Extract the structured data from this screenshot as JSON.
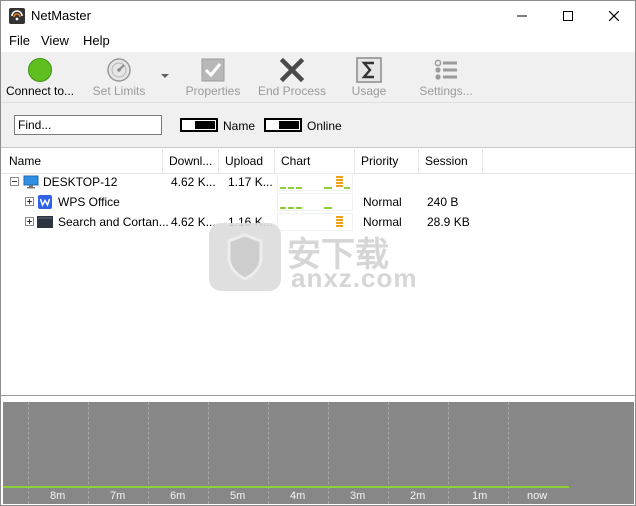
{
  "window": {
    "title": "NetMaster"
  },
  "menu": [
    "File",
    "View",
    "Help"
  ],
  "toolbar": {
    "connect": "Connect to...",
    "set_limits": "Set Limits",
    "properties": "Properties",
    "end_process": "End Process",
    "usage": "Usage",
    "settings": "Settings..."
  },
  "filter": {
    "find_placeholder": "Find...",
    "toggle1_label": "Name",
    "toggle2_label": "Online"
  },
  "table": {
    "columns": [
      "Name",
      "Downl...",
      "Upload",
      "Chart",
      "Priority",
      "Session"
    ],
    "rows": [
      {
        "name": "DESKTOP-12",
        "download": "4.62 K...",
        "upload": "1.17 K...",
        "priority": "",
        "session": ""
      },
      {
        "name": "WPS Office",
        "download": "",
        "upload": "",
        "priority": "Normal",
        "session": "240 B"
      },
      {
        "name": "Search and Cortan...",
        "download": "4.62 K...",
        "upload": "1.16 K...",
        "priority": "Normal",
        "session": "28.9 KB"
      }
    ]
  },
  "watermark": {
    "cn": "安下载",
    "url": "anxz.com"
  },
  "graph": {
    "time_labels": [
      "8m",
      "7m",
      "6m",
      "5m",
      "4m",
      "3m",
      "2m",
      "1m",
      "now"
    ]
  },
  "colors": {
    "connect_green": "#5fbf1f",
    "graph_bg": "#878787",
    "graph_line": "#8ccf3a",
    "chart_orange": "#f0a01c"
  }
}
